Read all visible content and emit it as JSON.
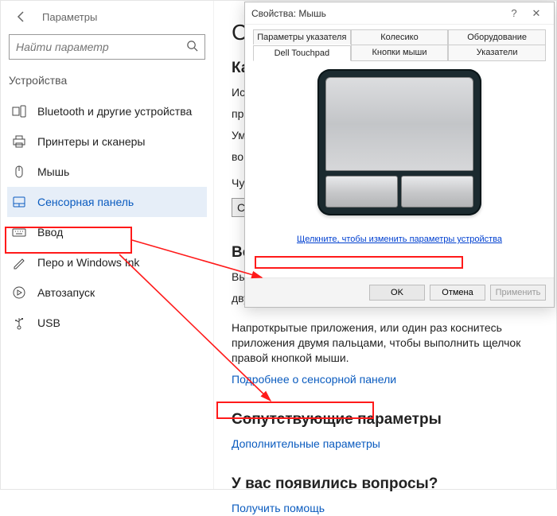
{
  "settings": {
    "back_tooltip": "Назад",
    "window_title": "Параметры",
    "search_placeholder": "Найти параметр",
    "section_label": "Устройства",
    "nav": [
      {
        "icon": "bluetooth",
        "label": "Bluetooth и другие устройства"
      },
      {
        "icon": "printer",
        "label": "Принтеры и сканеры"
      },
      {
        "icon": "mouse",
        "label": "Мышь"
      },
      {
        "icon": "touchpad",
        "label": "Сенсорная панель",
        "active": true
      },
      {
        "icon": "keyboard",
        "label": "Ввод"
      },
      {
        "icon": "pen",
        "label": "Перо и Windows Ink"
      },
      {
        "icon": "autoplay",
        "label": "Автозапуск"
      },
      {
        "icon": "usb",
        "label": "USB"
      }
    ],
    "content": {
      "h1_fragment": "Се",
      "h2_touch": "Кас",
      "p1": "Исп",
      "p2_lines": [
        "прав",
        "Умен",
        "во вр"
      ],
      "sens_label": "Чувс",
      "sens_button_fragment": "Ср",
      "h2_perf": "Воз",
      "perf_p_lines": [
        "Выпо",
        "двухк"
      ],
      "direction_p": "Напр­открытые приложения, или один раз коснитесь приложения двумя пальцами, чтобы выполнить щелчок правой кнопкой мыши.",
      "learn_more": "Подробнее о сенсорной панели",
      "h2_related": "Сопутствующие параметры",
      "addl_settings": "Дополнительные параметры",
      "h2_questions": "У вас появились вопросы?",
      "get_help": "Получить помощь"
    }
  },
  "dialog": {
    "title": "Свойства: Мышь",
    "tabs_row1": [
      "Параметры указателя",
      "Колесико",
      "Оборудование"
    ],
    "tabs_row2": [
      "Dell Touchpad",
      "Кнопки мыши",
      "Указатели"
    ],
    "active_tab": "Dell Touchpad",
    "change_link": "Щелкните, чтобы изменить параметры устройства",
    "buttons": {
      "ok": "OK",
      "cancel": "Отмена",
      "apply": "Применить"
    }
  }
}
